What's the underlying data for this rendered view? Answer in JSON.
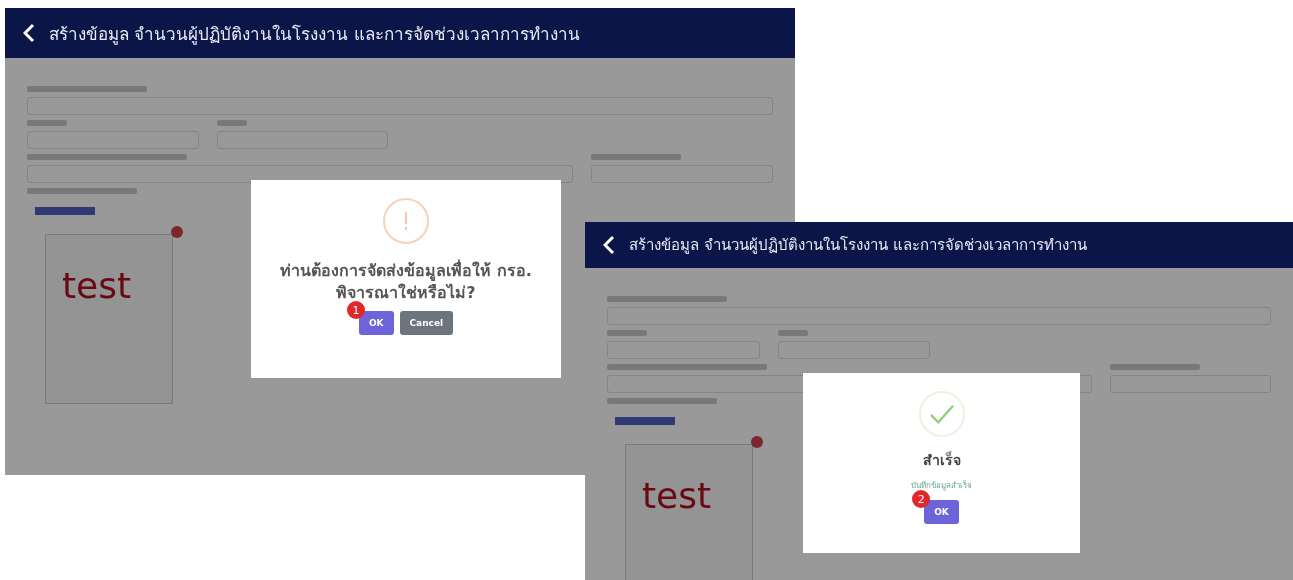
{
  "screens": [
    {
      "title": "สร้างข้อมูล จำนวนผู้ปฏิบัติงานในโรงงาน และการจัดช่วงเวลาการทำงาน",
      "image_text": "test",
      "dialog": {
        "kind": "confirm",
        "message": "ท่านต้องการจัดส่งข้อมูลเพื่อให้ กรอ. พิจารณาใช่หรือไม่?",
        "buttons": [
          {
            "label": "OK",
            "kind": "primary",
            "step": "1"
          },
          {
            "label": "Cancel",
            "kind": "secondary"
          }
        ]
      }
    },
    {
      "title": "สร้างข้อมูล จำนวนผู้ปฏิบัติงานในโรงงาน และการจัดช่วงเวลาการทำงาน",
      "image_text": "test",
      "dialog": {
        "kind": "success",
        "heading": "สำเร็จ",
        "message": "บันทึกข้อมูลสำเร็จ",
        "buttons": [
          {
            "label": "OK",
            "kind": "primary",
            "step": "2"
          }
        ]
      }
    }
  ]
}
